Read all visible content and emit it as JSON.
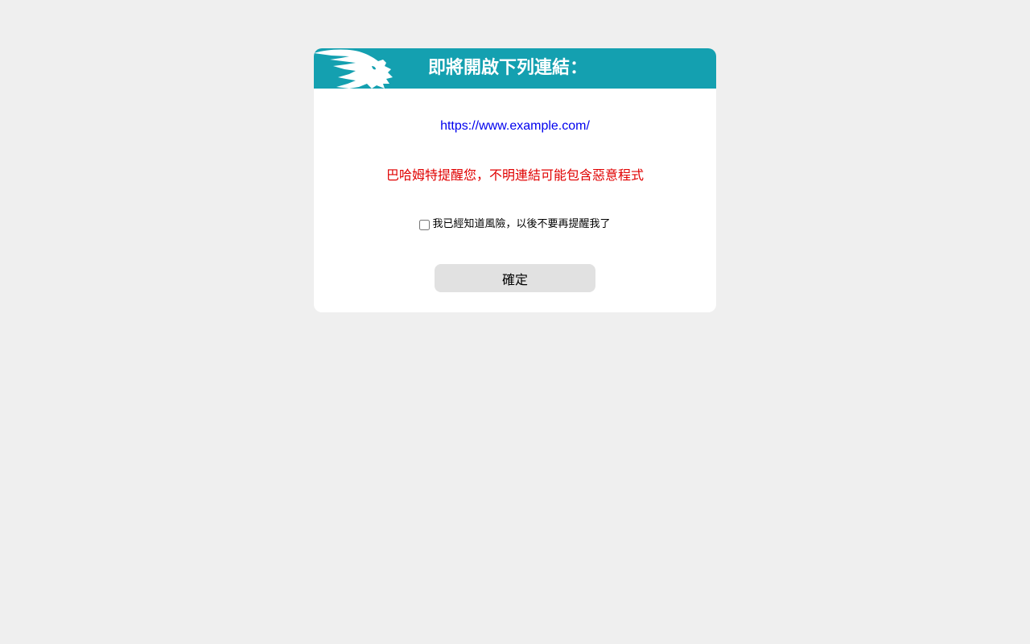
{
  "dialog": {
    "title": "即將開啟下列連結：",
    "url": "https://www.example.com/",
    "warning": "巴哈姆特提醒您，不明連結可能包含惡意程式",
    "remember_label": "我已經知道風險，以後不要再提醒我了",
    "remember_checked": false,
    "confirm_label": "確定",
    "logo_icon": "dragon-logo-icon"
  },
  "colors": {
    "background": "#efefef",
    "header": "#14a0b0",
    "link": "#0000ee",
    "warning": "#e00000",
    "button": "#e1e1e1"
  }
}
